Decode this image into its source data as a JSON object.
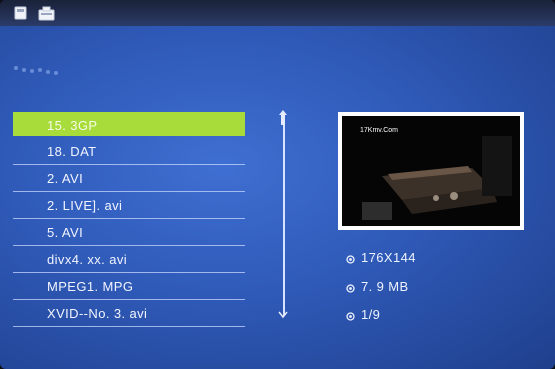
{
  "colors": {
    "background": "#2f5ab8",
    "selection": "#a8dc3a",
    "text": "#f2f5ff"
  },
  "files": [
    {
      "label": "15. 3GP",
      "selected": true
    },
    {
      "label": "18. DAT",
      "selected": false
    },
    {
      "label": "2. AVI",
      "selected": false
    },
    {
      "label": "2. LIVE]. avi",
      "selected": false
    },
    {
      "label": "5. AVI",
      "selected": false
    },
    {
      "label": "divx4. xx. avi",
      "selected": false
    },
    {
      "label": "MPEG1. MPG",
      "selected": false
    },
    {
      "label": "XVID--No. 3. avi",
      "selected": false
    }
  ],
  "preview": {
    "watermark": "17Kmv.Com"
  },
  "info": {
    "resolution": "176X144",
    "size": "7. 9 MB",
    "index": "1/9"
  }
}
